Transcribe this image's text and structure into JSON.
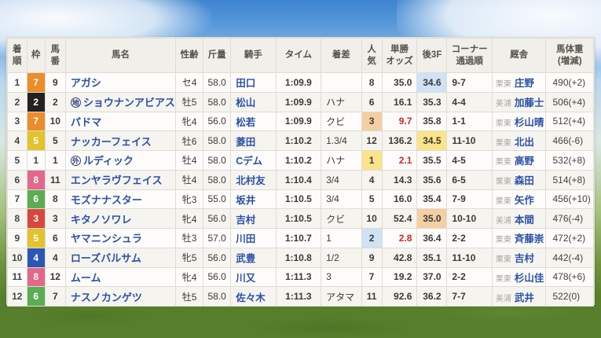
{
  "page": {
    "scene": "horse-race-result",
    "sky_color": "#3f84d0",
    "grass_color": "#577f2b"
  },
  "table": {
    "columns": [
      {
        "key": "pos",
        "label": "着\n順"
      },
      {
        "key": "frame",
        "label": "枠"
      },
      {
        "key": "num",
        "label": "馬\n番"
      },
      {
        "key": "name",
        "label": "馬名"
      },
      {
        "key": "sexage",
        "label": "性齢"
      },
      {
        "key": "load",
        "label": "斤量"
      },
      {
        "key": "jockey",
        "label": "騎手"
      },
      {
        "key": "time",
        "label": "タイム"
      },
      {
        "key": "margin",
        "label": "着差"
      },
      {
        "key": "pop",
        "label": "人\n気"
      },
      {
        "key": "odds",
        "label": "単勝\nオッズ"
      },
      {
        "key": "f3",
        "label": "後3F"
      },
      {
        "key": "corner",
        "label": "コーナー\n通過順"
      },
      {
        "key": "stable",
        "label": "厩舎"
      },
      {
        "key": "weight",
        "label": "馬体重\n(増減)"
      }
    ],
    "frame_colors": {
      "1": "#fdfcfa",
      "2": "#222222",
      "3": "#d9463e",
      "4": "#2b57b2",
      "5": "#e2c32f",
      "6": "#5bad52",
      "7": "#ec8c2b",
      "8": "#e2698b"
    },
    "highlight_colors": {
      "1": "#fbe389",
      "2": "#cfe2f6",
      "3": "#f3cfa3"
    },
    "link_color": "#2b50a7",
    "odds_low_color": "#cc2a24",
    "rows": [
      {
        "pos": "1",
        "frame": "7",
        "num": "9",
        "mark": "",
        "name": "アガシ",
        "sexage": "セ4",
        "load": "58.0",
        "jockey": "田口",
        "time": "1:09.9",
        "margin": "",
        "pop": "8",
        "odds": "35.0",
        "f3": "34.6",
        "corner": "9-7",
        "region": "栗東",
        "trainer": "庄野",
        "weight": "490(+2)"
      },
      {
        "pos": "2",
        "frame": "2",
        "num": "2",
        "mark": "地",
        "name": "ショウナンアビアス",
        "sexage": "牡5",
        "load": "58.0",
        "jockey": "松山",
        "time": "1:09.9",
        "margin": "ハナ",
        "pop": "6",
        "odds": "16.1",
        "f3": "35.3",
        "corner": "4-4",
        "region": "美浦",
        "trainer": "加藤士",
        "weight": "506(+4)"
      },
      {
        "pos": "3",
        "frame": "7",
        "num": "10",
        "mark": "",
        "name": "パドマ",
        "sexage": "牝4",
        "load": "56.0",
        "jockey": "松若",
        "time": "1:09.9",
        "margin": "クビ",
        "pop": "3",
        "odds": "9.7",
        "f3": "35.8",
        "corner": "1-1",
        "region": "栗東",
        "trainer": "杉山晴",
        "weight": "512(+4)"
      },
      {
        "pos": "4",
        "frame": "5",
        "num": "5",
        "mark": "",
        "name": "ナッカーフェイス",
        "sexage": "牡6",
        "load": "58.0",
        "jockey": "菱田",
        "time": "1:10.2",
        "margin": "1.3/4",
        "pop": "12",
        "odds": "136.2",
        "f3": "34.5",
        "corner": "11-10",
        "region": "栗東",
        "trainer": "北出",
        "weight": "466(-6)"
      },
      {
        "pos": "5",
        "frame": "1",
        "num": "1",
        "mark": "外",
        "name": "ルディック",
        "sexage": "牡4",
        "load": "58.0",
        "jockey": "Cデム",
        "time": "1:10.2",
        "margin": "ハナ",
        "pop": "1",
        "odds": "2.1",
        "f3": "35.5",
        "corner": "4-5",
        "region": "栗東",
        "trainer": "高野",
        "weight": "532(+8)"
      },
      {
        "pos": "6",
        "frame": "8",
        "num": "11",
        "mark": "",
        "name": "エンヤラヴフェイス",
        "sexage": "牡4",
        "load": "58.0",
        "jockey": "北村友",
        "time": "1:10.4",
        "margin": "3/4",
        "pop": "4",
        "odds": "14.3",
        "f3": "35.6",
        "corner": "6-5",
        "region": "栗東",
        "trainer": "森田",
        "weight": "514(+8)"
      },
      {
        "pos": "7",
        "frame": "6",
        "num": "8",
        "mark": "",
        "name": "モズナナスター",
        "sexage": "牝3",
        "load": "55.0",
        "jockey": "坂井",
        "time": "1:10.5",
        "margin": "3/4",
        "pop": "5",
        "odds": "16.0",
        "f3": "35.4",
        "corner": "7-9",
        "region": "栗東",
        "trainer": "矢作",
        "weight": "456(+10)"
      },
      {
        "pos": "8",
        "frame": "3",
        "num": "3",
        "mark": "",
        "name": "キタノソワレ",
        "sexage": "牝4",
        "load": "56.0",
        "jockey": "吉村",
        "time": "1:10.5",
        "margin": "クビ",
        "pop": "10",
        "odds": "52.4",
        "f3": "35.0",
        "corner": "10-10",
        "region": "美浦",
        "trainer": "本間",
        "weight": "476(-4)"
      },
      {
        "pos": "9",
        "frame": "5",
        "num": "6",
        "mark": "",
        "name": "ヤマニンシュラ",
        "sexage": "牡3",
        "load": "57.0",
        "jockey": "川田",
        "time": "1:10.7",
        "margin": "1",
        "pop": "2",
        "odds": "2.8",
        "f3": "36.4",
        "corner": "2-2",
        "region": "栗東",
        "trainer": "斉藤崇",
        "weight": "472(+2)"
      },
      {
        "pos": "10",
        "frame": "4",
        "num": "4",
        "mark": "",
        "name": "ローズバルサム",
        "sexage": "牝5",
        "load": "56.0",
        "jockey": "武豊",
        "time": "1:10.8",
        "margin": "1/2",
        "pop": "9",
        "odds": "42.8",
        "f3": "35.1",
        "corner": "11-10",
        "region": "栗東",
        "trainer": "吉村",
        "weight": "442(-4)"
      },
      {
        "pos": "11",
        "frame": "8",
        "num": "12",
        "mark": "",
        "name": "ムーム",
        "sexage": "牝4",
        "load": "56.0",
        "jockey": "川又",
        "time": "1:11.3",
        "margin": "3",
        "pop": "7",
        "odds": "19.2",
        "f3": "37.0",
        "corner": "2-2",
        "region": "栗東",
        "trainer": "杉山佳",
        "weight": "478(+6)"
      },
      {
        "pos": "12",
        "frame": "6",
        "num": "7",
        "mark": "",
        "name": "ナスノカンゲツ",
        "sexage": "牡5",
        "load": "58.0",
        "jockey": "佐々木",
        "time": "1:11.3",
        "margin": "アタマ",
        "pop": "11",
        "odds": "92.6",
        "f3": "36.2",
        "corner": "7-7",
        "region": "美浦",
        "trainer": "武井",
        "weight": "522(0)"
      }
    ]
  }
}
